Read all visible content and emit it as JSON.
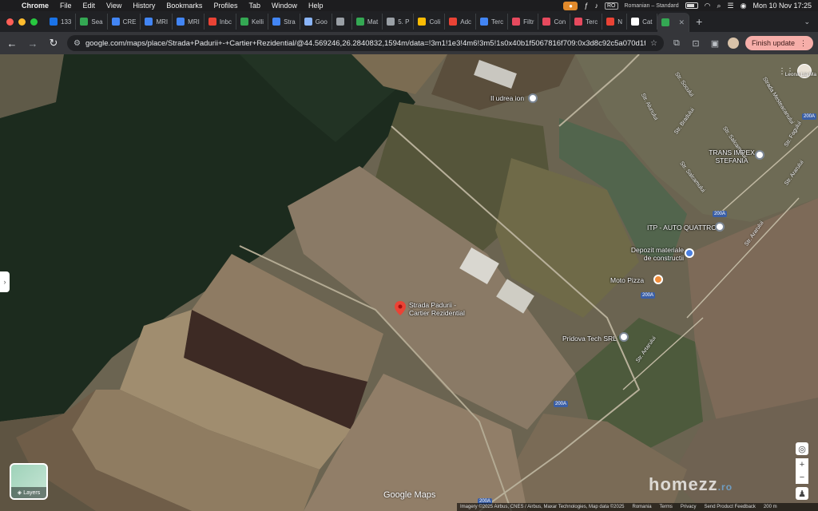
{
  "menubar": {
    "app": "Chrome",
    "menus": [
      "File",
      "Edit",
      "View",
      "History",
      "Bookmarks",
      "Profiles",
      "Tab",
      "Window",
      "Help"
    ],
    "lang_code": "RO",
    "keyboard": "Romanian – Standard",
    "datetime": "Mon 10 Nov  17:25"
  },
  "tabs": [
    {
      "label": "133",
      "color": "#1a73e8"
    },
    {
      "label": "Sea",
      "color": "#34a853"
    },
    {
      "label": "CRE",
      "color": "#4285f4"
    },
    {
      "label": "MRI",
      "color": "#4285f4"
    },
    {
      "label": "MRI",
      "color": "#4285f4"
    },
    {
      "label": "Inbc",
      "color": "#ea4335"
    },
    {
      "label": "Kelli",
      "color": "#34a853"
    },
    {
      "label": "Stra",
      "color": "#4285f4"
    },
    {
      "label": "Goo",
      "color": "#8ab4f8"
    },
    {
      "label": "",
      "color": "#9aa0a6"
    },
    {
      "label": "Mat",
      "color": "#34a853"
    },
    {
      "label": "5. P",
      "color": "#9aa0a6"
    },
    {
      "label": "Coli",
      "color": "#fbbc04"
    },
    {
      "label": "Adc",
      "color": "#ea4335"
    },
    {
      "label": "Terc",
      "color": "#4285f4"
    },
    {
      "label": "Filtr",
      "color": "#e64a5e"
    },
    {
      "label": "Con",
      "color": "#e64a5e"
    },
    {
      "label": "Terc",
      "color": "#e64a5e"
    },
    {
      "label": "N",
      "color": "#ea4335"
    },
    {
      "label": "Cat",
      "color": "#ffffff"
    },
    {
      "label": "",
      "color": "#34a853",
      "active": true
    }
  ],
  "toolbar": {
    "url": "google.com/maps/place/Strada+Padurii+-+Cartier+Rezidential/@44.569246,26.2840832,1594m/data=!3m1!1e3!4m6!3m5!1s0x40b1f5067816f709:0x3d8c92c5a070d1f0!8m2!3...",
    "finish_update": "Finish update"
  },
  "map": {
    "pin_label": "Strada Padurii - Cartier Rezidential",
    "pois": [
      {
        "name": "Il udrea ion"
      },
      {
        "name": "TRANS IMPEX STEFANIA"
      },
      {
        "name": "ITP - AUTO QUATTRO"
      },
      {
        "name": "Depozit materiale de constructii"
      },
      {
        "name": "Moto Pizza"
      },
      {
        "name": "Pridova Tech SRL"
      }
    ],
    "roads": [
      "Str. Socului",
      "Str. Alunului",
      "Str. Bradului",
      "Strada Mesteacanului",
      "Str. Fagului",
      "Str. Salcamului",
      "Str. Ararului",
      "Str. Ararului",
      "Str. Salcamului",
      "Str. Artarului"
    ],
    "shields": [
      "200A",
      "200A",
      "200A",
      "200A",
      "200A"
    ],
    "layers_label": "Layers",
    "logo": "Google Maps",
    "account_label": "Leona Lia Ma",
    "attribution": [
      "Imagery ©2025 Airbus, CNES / Airbus, Maxar Technologies, Map data ©2025",
      "Romania",
      "Terms",
      "Privacy",
      "Send Product Feedback",
      "200 m"
    ],
    "watermark": "homezz",
    "watermark_suffix": ".ro"
  }
}
